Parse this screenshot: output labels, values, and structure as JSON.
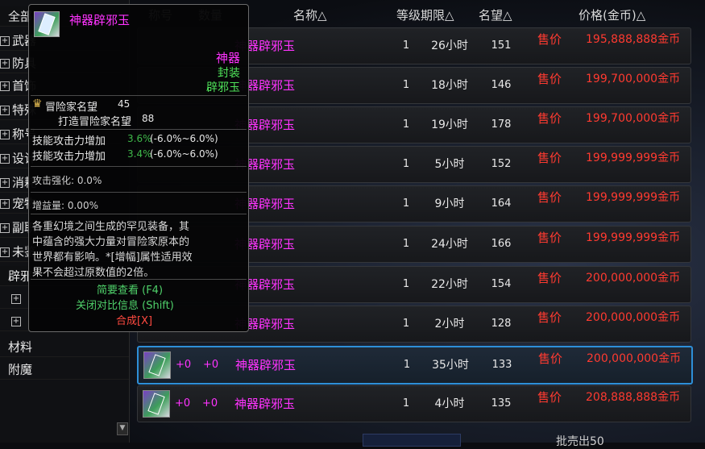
{
  "sidebar": {
    "categories": [
      {
        "label": "全部",
        "type": "head"
      },
      {
        "label": "武器",
        "type": "plus"
      },
      {
        "label": "防具",
        "type": "plus"
      },
      {
        "label": "首饰",
        "type": "plus"
      },
      {
        "label": "特殊",
        "type": "plus"
      },
      {
        "label": "称号",
        "type": "plus"
      },
      {
        "label": "设计",
        "type": "plus"
      },
      {
        "label": "消耗",
        "type": "plus"
      },
      {
        "label": "宠物",
        "type": "plus"
      },
      {
        "label": "副职",
        "type": "plus"
      },
      {
        "label": "未鉴",
        "type": "plus"
      },
      {
        "label": "辟邪",
        "type": "head"
      },
      {
        "label": "",
        "type": "plus"
      },
      {
        "label": "",
        "type": "plus"
      },
      {
        "label": "材料",
        "type": "plain"
      },
      {
        "label": "附魔",
        "type": "plain"
      }
    ]
  },
  "table": {
    "headers": {
      "col1": "称号",
      "col2": "数量",
      "name": "名称△",
      "level_duration": "等级期限△",
      "reputation": "名望△",
      "price": "价格(金币)△"
    },
    "rows": [
      {
        "name": "神器辟邪玉",
        "level": "1",
        "duration": "26小时",
        "reputation": "151",
        "price_label": "售价",
        "price": "195,888,888金币"
      },
      {
        "name": "神器辟邪玉",
        "level": "1",
        "duration": "18小时",
        "reputation": "146",
        "price_label": "售价",
        "price": "199,700,000金币"
      },
      {
        "name": "神器辟邪玉",
        "level": "1",
        "duration": "19小时",
        "reputation": "178",
        "price_label": "售价",
        "price": "199,700,000金币"
      },
      {
        "name": "神器辟邪玉",
        "level": "1",
        "duration": "5小时",
        "reputation": "152",
        "price_label": "售价",
        "price": "199,999,999金币"
      },
      {
        "name": "神器辟邪玉",
        "level": "1",
        "duration": "9小时",
        "reputation": "164",
        "price_label": "售价",
        "price": "199,999,999金币"
      },
      {
        "name": "神器辟邪玉",
        "level": "1",
        "duration": "24小时",
        "reputation": "166",
        "price_label": "售价",
        "price": "199,999,999金币"
      },
      {
        "name": "神器辟邪玉",
        "level": "1",
        "duration": "22小时",
        "reputation": "154",
        "price_label": "售价",
        "price": "200,000,000金币"
      },
      {
        "name": "神器辟邪玉",
        "level": "1",
        "duration": "2小时",
        "reputation": "128",
        "price_label": "售价",
        "price": "200,000,000金币"
      },
      {
        "name": "神器辟邪玉",
        "level": "1",
        "duration": "35小时",
        "reputation": "133",
        "price_label": "售价",
        "price": "200,000,000金币",
        "plus_a": "+0",
        "plus_b": "+0",
        "selected": true
      },
      {
        "name": "神器辟邪玉",
        "level": "1",
        "duration": "4小时",
        "reputation": "135",
        "price_label": "售价",
        "price": "208,888,888金币",
        "plus_a": "+0",
        "plus_b": "+0"
      }
    ]
  },
  "tooltip": {
    "title": "神器辟邪玉",
    "rarity": "神器",
    "bind": "封装",
    "type": "辟邪玉",
    "adv_rep_label": "冒险家名望",
    "adv_rep_value": "45",
    "forge_rep_label": "打造冒险家名望",
    "forge_rep_value": "88",
    "skill1_label": "技能攻击力增加",
    "skill1_value": "3.6%",
    "skill1_range": "(-6.0%~6.0%)",
    "skill2_label": "技能攻击力增加",
    "skill2_value": "3.4%",
    "skill2_range": "(-6.0%~6.0%)",
    "attack_enh": "攻击强化: 0.0%",
    "buff": "增益量: 0.00%",
    "desc1": "各重幻境之间生成的罕见装备，其",
    "desc2": "中蕴含的强大力量对冒险家原本的",
    "desc3": "世界都有影响。*[增幅]属性适用效",
    "desc4": "果不会超过原数值的2倍。",
    "action_brief": "简要查看 (F4)",
    "action_close": "关闭对比信息 (Shift)",
    "action_synth": "合成[X]"
  },
  "footer": {
    "sold_label": "批売出50"
  },
  "colors": {
    "accent": "#2e8fd8",
    "price_red": "#ff3a30",
    "name_magenta": "#ff33ff",
    "rarity_magenta": "#ff33ff",
    "green": "#4fe35a",
    "stat_value": "#3fb94a",
    "action_green": "#4fd16a",
    "synth_red": "#ff4a40"
  }
}
